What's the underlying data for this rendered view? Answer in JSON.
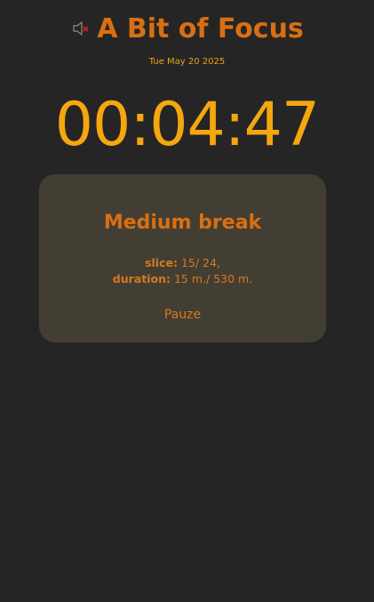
{
  "header": {
    "title": "A Bit of Focus",
    "mute_icon": "speaker-muted-icon"
  },
  "date": "Tue May 20 2025",
  "timer": {
    "display": "00:04:47"
  },
  "session": {
    "phase": "Medium break",
    "slice_label": "slice:",
    "slice_value": "15/ 24,",
    "duration_label": "duration:",
    "duration_value": "15 m./ 530 m.",
    "pause_label": "Pauze"
  },
  "colors": {
    "background": "#252525",
    "card": "#433e33",
    "accent_orange": "#d96f12",
    "timer_amber": "#f5a70f",
    "mute_x_red": "#e01d1d"
  }
}
